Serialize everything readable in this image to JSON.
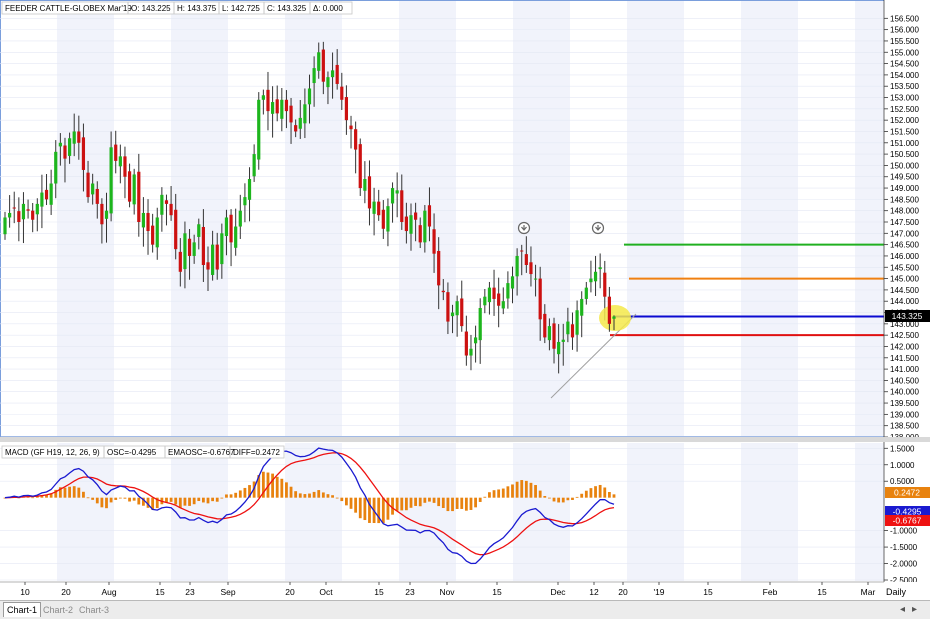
{
  "price_panel": {
    "info": {
      "symbol": "FEEDER CATTLE-GLOBEX Mar'19",
      "open": "O: 143.225",
      "high": "H: 143.375",
      "low": "L: 142.725",
      "close": "C: 143.325",
      "change": "Δ: 0.000"
    },
    "last_price_label": "143.325",
    "colors": {
      "up": "#1db51d",
      "down": "#cc1111",
      "wick": "#333333",
      "last_tag_bg": "#000000"
    }
  },
  "macd_panel": {
    "info": {
      "title": "MACD (GF H19, 12, 26, 9)",
      "osc": "OSC=-0.4295",
      "emaosc": "EMAOSC=-0.6767",
      "diff": "DIFF=0.2472"
    },
    "tags": {
      "diff": "0.2472",
      "osc": "-0.4295",
      "emaosc": "-0.6767"
    },
    "colors": {
      "histogram": "#e8820e",
      "osc": "#1a1ad0",
      "emaosc": "#ee1111"
    }
  },
  "x_axis_labels": [
    "10",
    "20",
    "Aug",
    "15",
    "23",
    "Sep",
    "20",
    "Oct",
    "15",
    "23",
    "Nov",
    "15",
    "Dec",
    "12",
    "20",
    "'19",
    "15",
    "Feb",
    "15",
    "Mar"
  ],
  "x_axis_daily_label": "Daily",
  "tabs": [
    "Chart-1",
    "Chart-2",
    "Chart-3"
  ],
  "chart_data": [
    {
      "type": "candlestick",
      "title": "FEEDER CATTLE-GLOBEX Mar'19",
      "ylim": [
        138.0,
        157.0
      ],
      "y_ticks": [
        138.0,
        138.5,
        139.0,
        139.5,
        140.0,
        140.5,
        141.0,
        141.5,
        142.0,
        142.5,
        143.0,
        143.5,
        144.0,
        144.5,
        145.0,
        145.5,
        146.0,
        146.5,
        147.0,
        147.5,
        148.0,
        148.5,
        149.0,
        149.5,
        150.0,
        150.5,
        151.0,
        151.5,
        152.0,
        152.5,
        153.0,
        153.5,
        154.0,
        154.5,
        155.0,
        155.5,
        156.0,
        156.5
      ],
      "y_tick_labels": [
        "138.000",
        "138.500",
        "139.000",
        "139.500",
        "140.000",
        "140.500",
        "141.000",
        "141.500",
        "142.000",
        "142.500",
        "143.000",
        "143.500",
        "144.000",
        "144.500",
        "145.000",
        "145.500",
        "146.000",
        "146.500",
        "147.000",
        "147.500",
        "148.000",
        "148.500",
        "149.000",
        "149.500",
        "150.000",
        "150.500",
        "151.000",
        "151.500",
        "152.000",
        "152.500",
        "153.000",
        "153.500",
        "154.000",
        "154.500",
        "155.000",
        "155.500",
        "156.000",
        "156.500"
      ],
      "closes": [
        147.7,
        147.9,
        148.1,
        147.5,
        148.3,
        148.0,
        147.6,
        148.3,
        148.8,
        148.5,
        149.2,
        150.6,
        151.0,
        150.3,
        151.2,
        151.5,
        151.0,
        149.8,
        148.6,
        149.2,
        148.3,
        147.4,
        148.0,
        150.8,
        150.2,
        150.4,
        149.5,
        148.4,
        149.6,
        147.5,
        147.9,
        147.1,
        146.5,
        147.7,
        148.7,
        148.3,
        147.8,
        146.3,
        145.3,
        147.0,
        146.0,
        146.6,
        147.4,
        145.6,
        145.4,
        146.5,
        145.4,
        147.0,
        147.7,
        146.6,
        147.3,
        148.0,
        148.6,
        149.4,
        150.5,
        152.9,
        153.1,
        152.4,
        152.8,
        152.3,
        152.9,
        152.4,
        151.9,
        151.5,
        152.1,
        152.7,
        153.4,
        154.3,
        155.0,
        153.7,
        153.9,
        154.2,
        153.6,
        152.9,
        152.0,
        151.6,
        150.7,
        149.0,
        149.4,
        148.1,
        148.4,
        147.8,
        147.2,
        148.2,
        149.0,
        148.9,
        147.5,
        147.1,
        147.8,
        147.6,
        146.6,
        148.0,
        147.3,
        146.1,
        144.7,
        144.4,
        143.1,
        143.5,
        144.0,
        142.9,
        141.6,
        141.9,
        142.4,
        143.7,
        144.2,
        144.6,
        144.1,
        143.8,
        144.0,
        144.8,
        145.1,
        146.0,
        146.2,
        145.6,
        145.2,
        145.0,
        143.2,
        142.4,
        142.9,
        141.9,
        142.2,
        142.3,
        143.1,
        142.4,
        143.6,
        144.1,
        144.6,
        145.0,
        145.3,
        145.5,
        144.2,
        143.0,
        143.325
      ],
      "overlay_lines": [
        {
          "name": "green level",
          "value": 146.5,
          "color": "#20b020"
        },
        {
          "name": "orange level",
          "value": 145.0,
          "color": "#f08010"
        },
        {
          "name": "blue level",
          "value": 143.325,
          "color": "#0a0ad0"
        },
        {
          "name": "red level",
          "value": 142.5,
          "color": "#e01010"
        }
      ]
    },
    {
      "type": "line",
      "title": "MACD (GF H19, 12, 26, 9)",
      "ylim": [
        -2.5,
        1.6
      ],
      "y_ticks": [
        1.5,
        1.0,
        0.5,
        -1.0,
        -1.5,
        -2.0,
        -2.5
      ],
      "y_tick_labels": [
        "1.5000",
        "1.0000",
        "0.5000",
        "-1.0000",
        "-1.5000",
        "-2.0000",
        "-2.5000"
      ]
    }
  ]
}
